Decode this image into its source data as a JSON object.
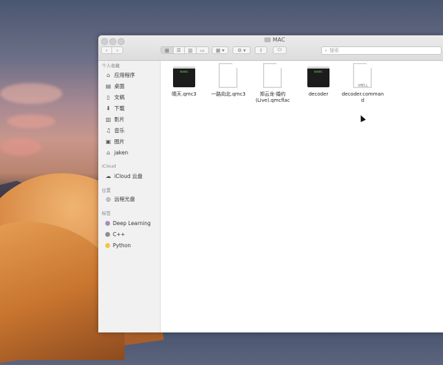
{
  "window": {
    "title": "MAC",
    "search_placeholder": "搜索"
  },
  "toolbar": {
    "back_icon": "chevron-left-icon",
    "forward_icon": "chevron-right-icon",
    "views": [
      "icon-view",
      "list-view",
      "column-view",
      "gallery-view"
    ],
    "group_icon": "group-icon",
    "action_icon": "gear-icon",
    "share_icon": "share-icon",
    "tag_icon": "tag-icon"
  },
  "sidebar": {
    "favorites_title": "个人收藏",
    "favorites": [
      {
        "label": "应用程序",
        "icon": "applications-icon"
      },
      {
        "label": "桌面",
        "icon": "desktop-icon"
      },
      {
        "label": "文稿",
        "icon": "documents-icon"
      },
      {
        "label": "下载",
        "icon": "downloads-icon"
      },
      {
        "label": "影片",
        "icon": "movies-icon"
      },
      {
        "label": "音乐",
        "icon": "music-icon"
      },
      {
        "label": "图片",
        "icon": "pictures-icon"
      },
      {
        "label": "jaken",
        "icon": "home-icon"
      }
    ],
    "icloud_title": "iCloud",
    "icloud": [
      {
        "label": "iCloud 云盘",
        "icon": "cloud-icon"
      }
    ],
    "locations_title": "位置",
    "locations": [
      {
        "label": "远程光盘",
        "icon": "disc-icon"
      }
    ],
    "tags_title": "标签",
    "tags": [
      {
        "label": "Deep Learning",
        "color": "#a98bb8"
      },
      {
        "label": "C++",
        "color": "#8e8e93"
      },
      {
        "label": "Python",
        "color": "#f5c342"
      }
    ]
  },
  "files": [
    {
      "name": "晴天.qmc3",
      "kind": "terminal",
      "badge": "exec"
    },
    {
      "name": "一路向北.qmc3",
      "kind": "document"
    },
    {
      "name": "郑云龙-婚约\n(Live).qmcflac",
      "kind": "document"
    },
    {
      "name": "decoder",
      "kind": "terminal",
      "badge": "exec"
    },
    {
      "name": "decoder.comman\nd",
      "kind": "shell",
      "badge": "SHELL"
    }
  ]
}
